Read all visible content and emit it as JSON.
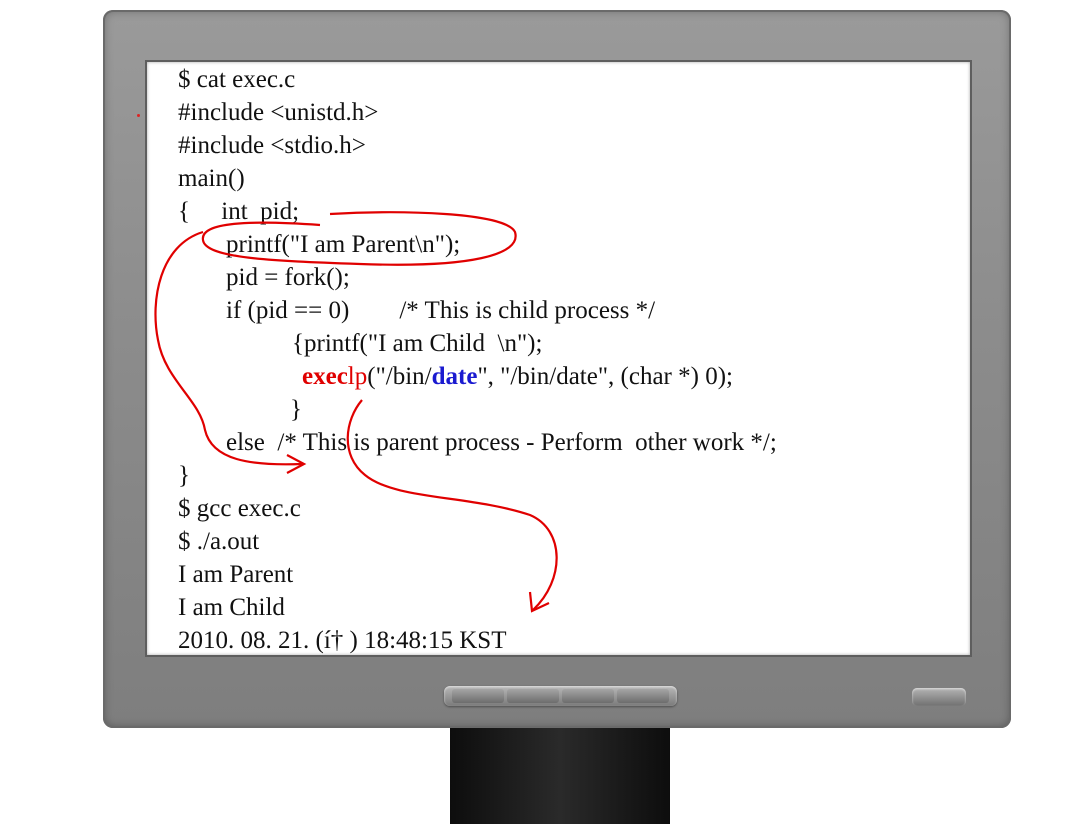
{
  "code_lines": [
    "$ cat exec.c",
    "#include <unistd.h>",
    "#include <stdio.h>",
    "main()",
    "{     int  pid;",
    "printf(\"I am Parent\\n\");",
    "pid = fork();",
    "if (pid == 0)        /* This is child process */",
    "{printf(\"I am Child  \\n\");",
    "(\"/bin/",
    "\", \"/bin/date\", (char *) 0);",
    "}",
    "else  /* This is parent process - Perform  other work */;",
    "}",
    "$ gcc exec.c",
    "$ ./a.out",
    "I am Parent",
    "I am Child",
    "2010. 08. 21. (í† ) 18:48:15 KST"
  ],
  "execlp_line": {
    "func_bold": "exec",
    "func_plain": "lp",
    "arg_prefix": "(\"/bin/",
    "arg_bold": "date",
    "arg_suffix": "\", \"/bin/date\", (char *) 0);"
  },
  "colors": {
    "annotation_red": "#e00000",
    "keyword_red": "#e00000",
    "keyword_blue": "#1a1ad0",
    "monitor_gray": "#8c8c8c",
    "stand_black": "#111111"
  },
  "icons": [
    "monitor-bezel",
    "monitor-stand",
    "monitor-control-buttons",
    "power-button"
  ]
}
